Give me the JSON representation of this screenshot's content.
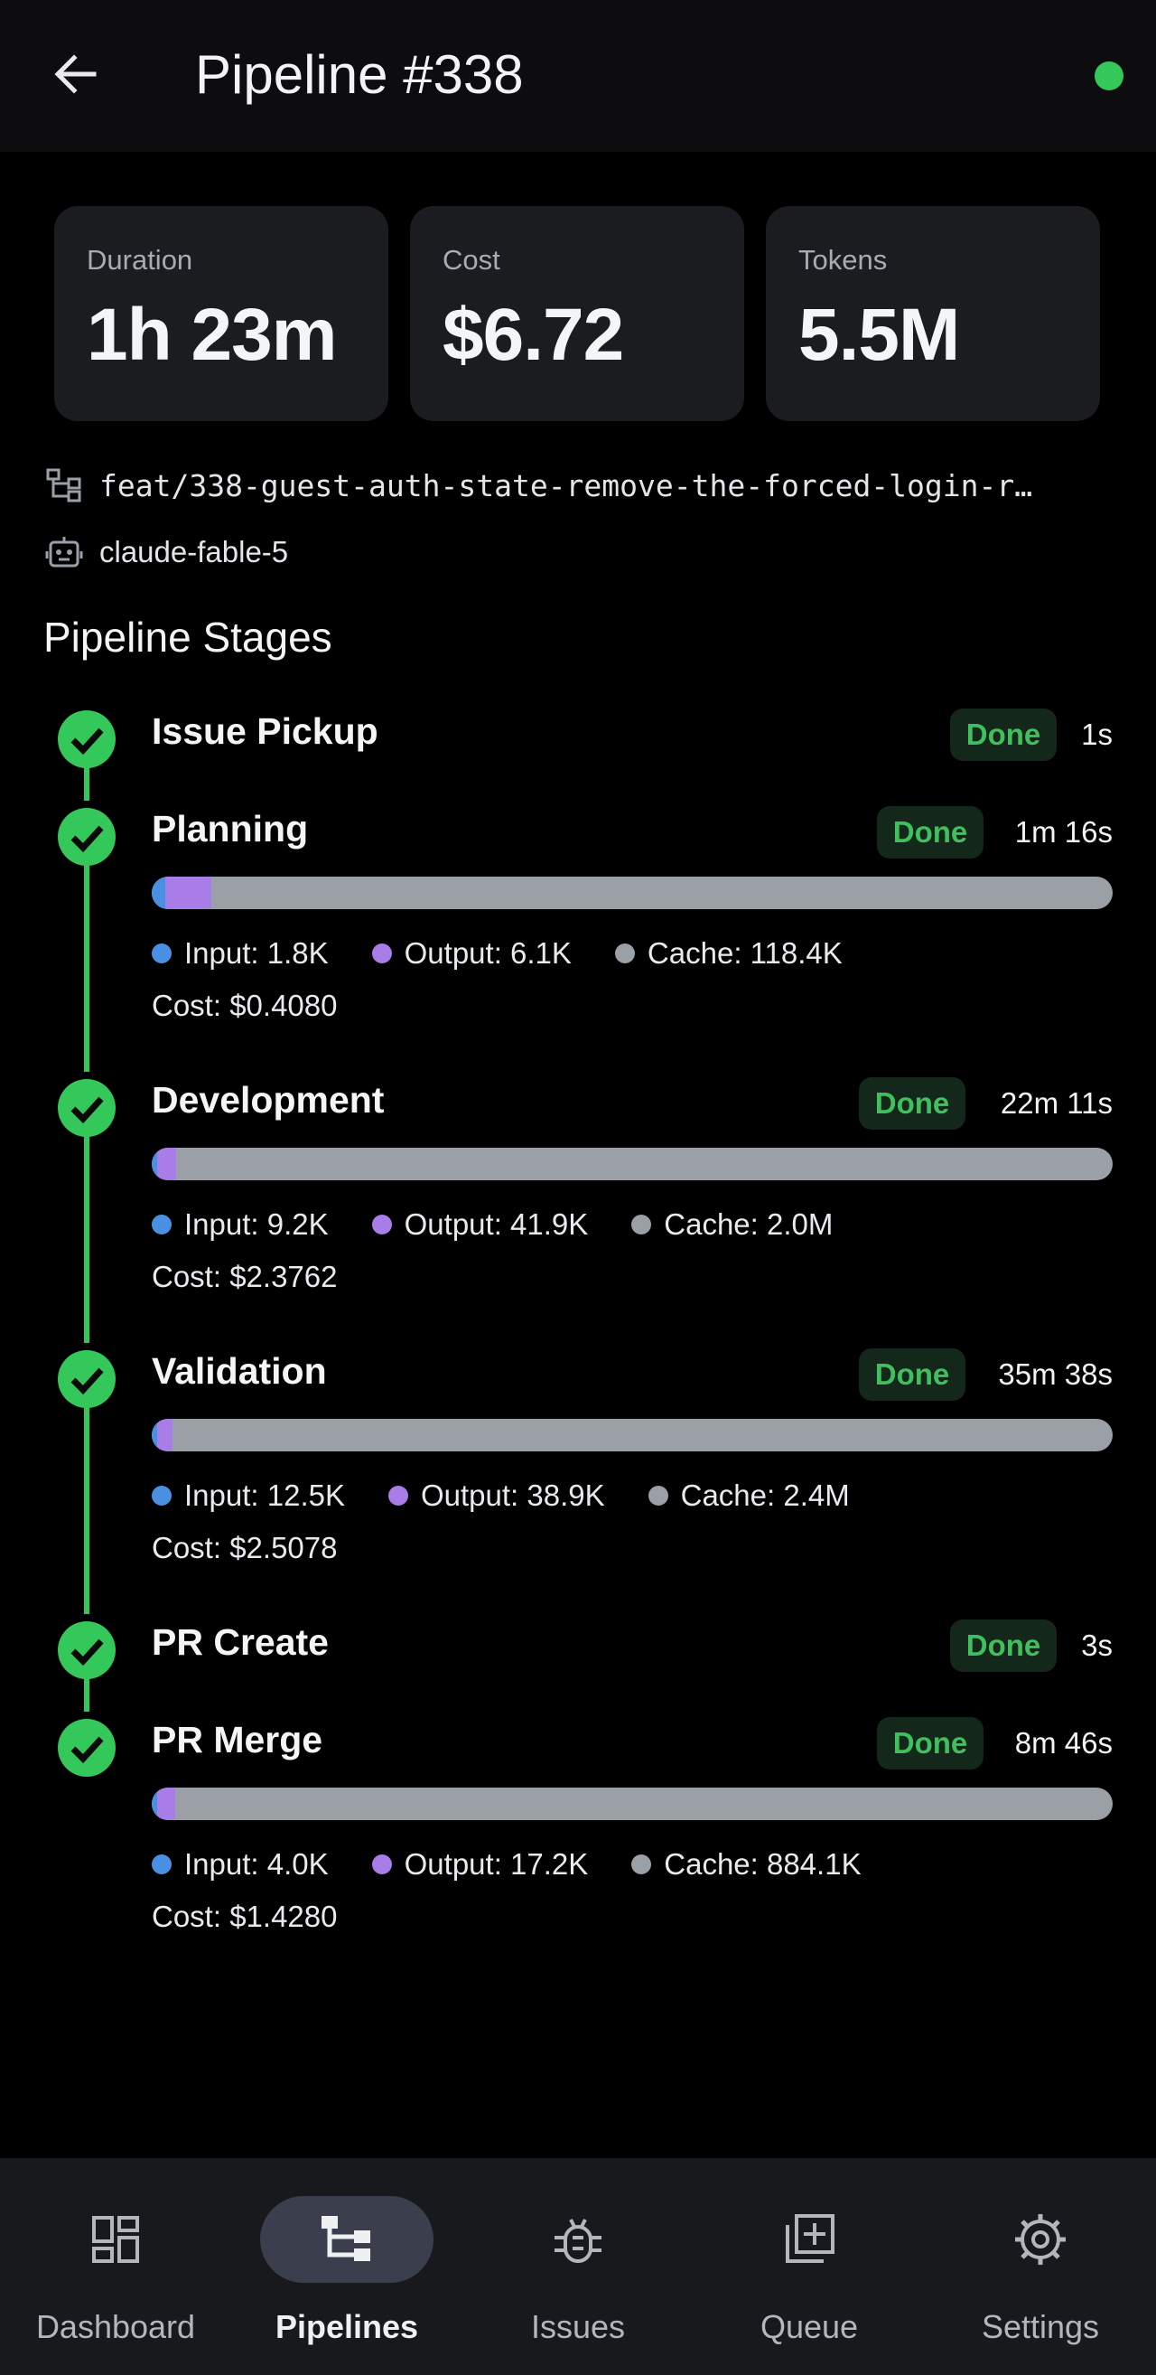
{
  "header": {
    "title": "Pipeline #338"
  },
  "stats": {
    "duration": {
      "label": "Duration",
      "value": "1h 23m"
    },
    "cost": {
      "label": "Cost",
      "value": "$6.72"
    },
    "tokens": {
      "label": "Tokens",
      "value": "5.5M"
    }
  },
  "meta": {
    "branch": "feat/338-guest-auth-state-remove-the-forced-login-r…",
    "model": "claude-fable-5"
  },
  "section_title": "Pipeline Stages",
  "stages": [
    {
      "name": "Issue Pickup",
      "status": "Done",
      "duration": "1s"
    },
    {
      "name": "Planning",
      "status": "Done",
      "duration": "1m 16s",
      "input": "Input: 1.8K",
      "output": "Output: 6.1K",
      "cache": "Cache: 118.4K",
      "cost": "Cost: $0.4080",
      "input_fraction": 0.014,
      "output_fraction": 0.048
    },
    {
      "name": "Development",
      "status": "Done",
      "duration": "22m 11s",
      "input": "Input: 9.2K",
      "output": "Output: 41.9K",
      "cache": "Cache: 2.0M",
      "cost": "Cost: $2.3762",
      "input_fraction": 0.0045,
      "output_fraction": 0.02
    },
    {
      "name": "Validation",
      "status": "Done",
      "duration": "35m 38s",
      "input": "Input: 12.5K",
      "output": "Output: 38.9K",
      "cache": "Cache: 2.4M",
      "cost": "Cost: $2.5078",
      "input_fraction": 0.005,
      "output_fraction": 0.016
    },
    {
      "name": "PR Create",
      "status": "Done",
      "duration": "3s"
    },
    {
      "name": "PR Merge",
      "status": "Done",
      "duration": "8m 46s",
      "input": "Input: 4.0K",
      "output": "Output: 17.2K",
      "cache": "Cache: 884.1K",
      "cost": "Cost: $1.4280",
      "input_fraction": 0.0044,
      "output_fraction": 0.019
    }
  ],
  "nav": [
    {
      "label": "Dashboard",
      "icon": "dashboard-icon"
    },
    {
      "label": "Pipelines",
      "icon": "pipelines-icon",
      "active": true
    },
    {
      "label": "Issues",
      "icon": "bug-icon"
    },
    {
      "label": "Queue",
      "icon": "queue-icon"
    },
    {
      "label": "Settings",
      "icon": "gear-icon"
    }
  ],
  "colors": {
    "success": "#34c759",
    "input": "#4a90e2",
    "output": "#a97de8",
    "cache": "#9aa0a6"
  }
}
